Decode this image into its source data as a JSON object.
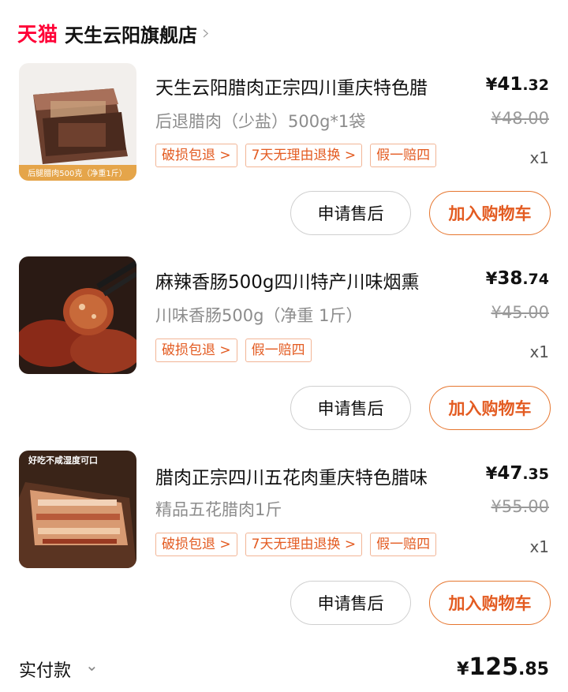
{
  "shop": {
    "logo": "天猫",
    "name": "天生云阳旗舰店",
    "arrow_icon": "chevron-right-icon"
  },
  "items": [
    {
      "title": "天生云阳腊肉正宗四川重庆特色腊",
      "price_int": "41",
      "price_dec": ".32",
      "currency": "¥",
      "sku": "后退腊肉（少盐）500g*1袋",
      "original_price": "¥48.00",
      "tags": [
        "破损包退 >",
        "7天无理由退换 >",
        "假一赔四"
      ],
      "quantity": "x1",
      "thumb_caption": "后腿腊肉500克（净重1斤）",
      "after_sales": "申请售后",
      "add_cart": "加入购物车"
    },
    {
      "title": "麻辣香肠500g四川特产川味烟熏",
      "price_int": "38",
      "price_dec": ".74",
      "currency": "¥",
      "sku": "川味香肠500g（净重 1斤）",
      "original_price": "¥45.00",
      "tags": [
        "破损包退 >",
        "假一赔四"
      ],
      "quantity": "x1",
      "after_sales": "申请售后",
      "add_cart": "加入购物车"
    },
    {
      "title": "腊肉正宗四川五花肉重庆特色腊味",
      "price_int": "47",
      "price_dec": ".35",
      "currency": "¥",
      "sku": "精品五花腊肉1斤",
      "original_price": "¥55.00",
      "tags": [
        "破损包退 >",
        "7天无理由退换 >",
        "假一赔四"
      ],
      "quantity": "x1",
      "thumb_caption": "好吃不咸湿度可口",
      "after_sales": "申请售后",
      "add_cart": "加入购物车"
    }
  ],
  "total": {
    "label": "实付款",
    "currency": "¥",
    "amount_int": "125",
    "amount_dec": ".85"
  }
}
